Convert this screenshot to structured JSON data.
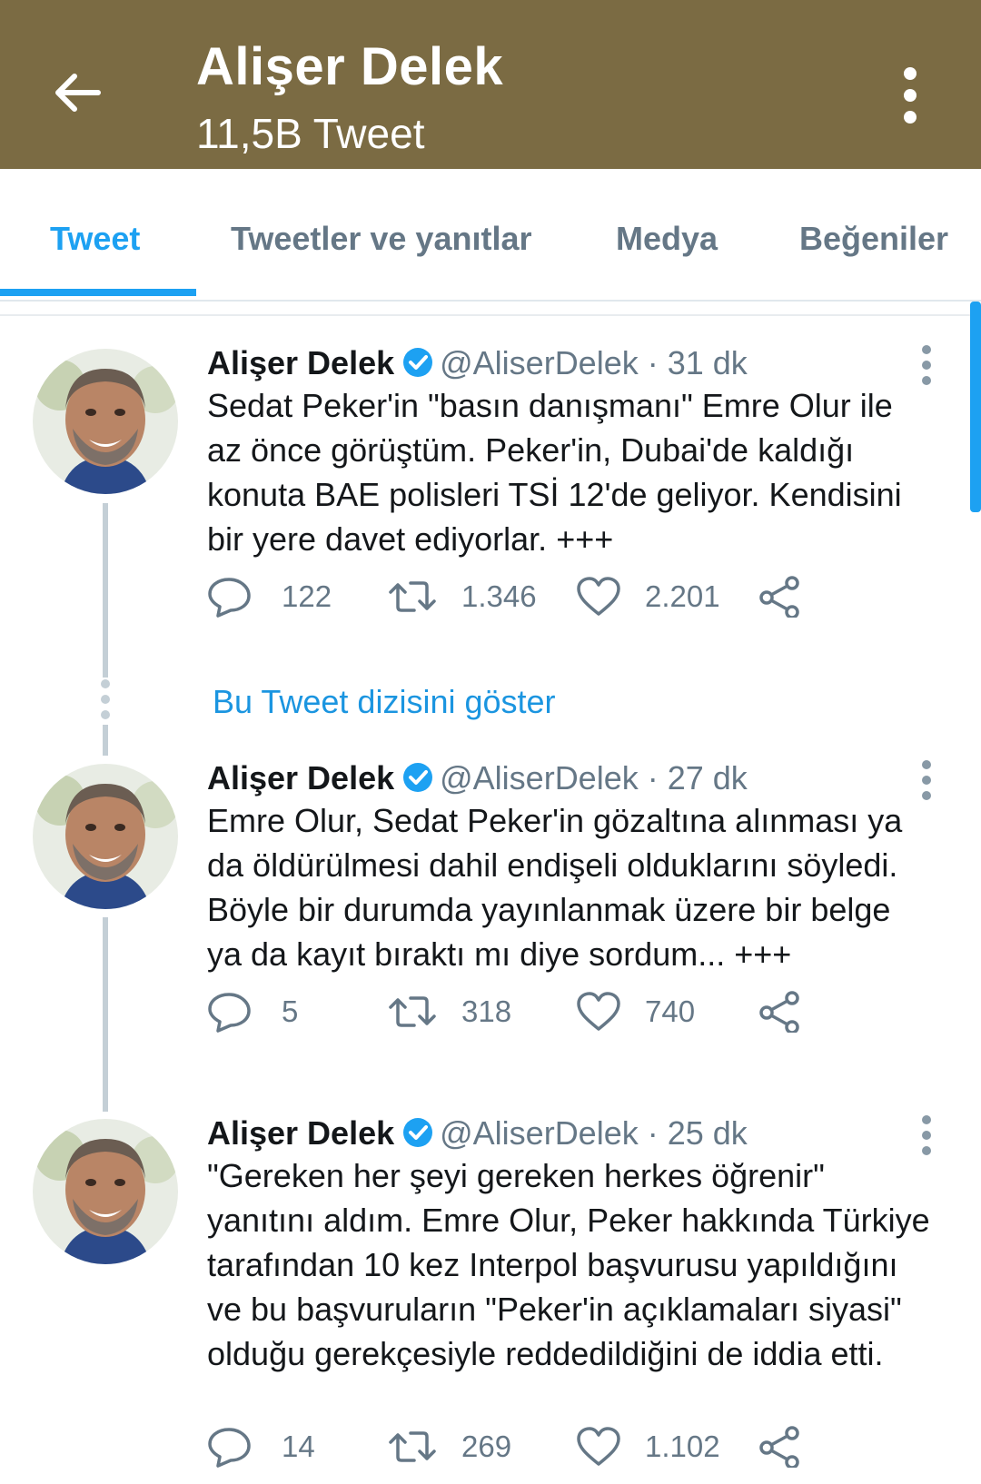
{
  "header": {
    "title": "Alişer Delek",
    "subtitle": "11,5B Tweet",
    "background": "#7b6b43"
  },
  "tabs": [
    {
      "label": "Tweet",
      "active": true
    },
    {
      "label": "Tweetler ve yanıtlar",
      "active": false
    },
    {
      "label": "Medya",
      "active": false
    },
    {
      "label": "Beğeniler",
      "active": false
    }
  ],
  "show_thread_label": "Bu Tweet dizisini göster",
  "tweets": [
    {
      "name": "Alişer Delek",
      "handle": "@AliserDelek",
      "time": "· 31 dk",
      "text": "Sedat Peker'in \"basın danışmanı\" Emre Olur ile\naz önce görüştüm. Peker'in, Dubai'de kaldığı\nkonuta BAE polisleri TSİ 12'de geliyor. Kendisini\nbir yere davet ediyorlar.  +++",
      "replies": "122",
      "retweets": "1.346",
      "likes": "2.201"
    },
    {
      "name": "Alişer Delek",
      "handle": "@AliserDelek",
      "time": "· 27 dk",
      "text": "Emre Olur, Sedat Peker'in gözaltına alınması ya\nda öldürülmesi dahil endişeli olduklarını söyledi.\nBöyle bir durumda yayınlanmak üzere bir belge\nya da kayıt bıraktı mı diye sordum... +++",
      "replies": "5",
      "retweets": "318",
      "likes": "740"
    },
    {
      "name": "Alişer Delek",
      "handle": "@AliserDelek",
      "time": "· 25 dk",
      "text": "\"Gereken her şeyi gereken herkes öğrenir\"\nyanıtını aldım. Emre Olur, Peker hakkında Türkiye\ntarafından 10 kez Interpol başvurusu yapıldığını\nve bu başvuruların \"Peker'in açıklamaları siyasi\"\nolduğu gerekçesiyle reddedildiğini de iddia etti.",
      "replies": "14",
      "retweets": "269",
      "likes": "1.102"
    }
  ],
  "icons": {
    "back": "arrow-left-icon",
    "more": "more-vertical-icon",
    "verified": "verified-badge-icon",
    "reply": "reply-icon",
    "retweet": "retweet-icon",
    "like": "heart-icon",
    "share": "share-icon"
  },
  "colors": {
    "accent": "#1da1f2",
    "link": "#1b95e0",
    "muted": "#657786"
  }
}
